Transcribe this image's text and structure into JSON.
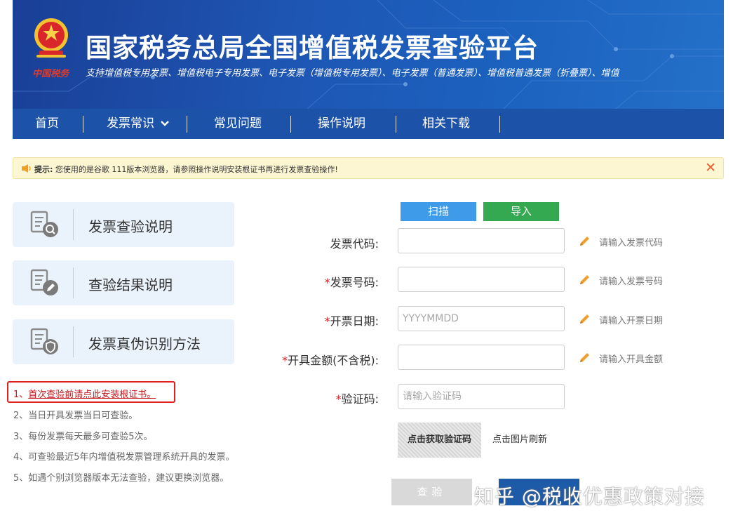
{
  "header": {
    "title": "国家税务总局全国增值税发票查验平台",
    "subtitle": "支持增值税专用发票、增值税电子专用发票、电子发票（增值税专用发票）、电子发票（普通发票）、增值税普通发票（折叠票）、增值",
    "emblem_caption": "中国税务"
  },
  "nav": {
    "items": [
      {
        "label": "首页"
      },
      {
        "label": "发票常识",
        "has_dropdown": true
      },
      {
        "label": "常见问题"
      },
      {
        "label": "操作说明"
      },
      {
        "label": "相关下载"
      }
    ]
  },
  "notice": {
    "prefix": "提示:",
    "text": "您使用的是谷歌 111版本浏览器，请参照操作说明安装根证书再进行发票查验操作!",
    "close": "✕"
  },
  "sidebar": {
    "cards": [
      {
        "label": "发票查验说明",
        "icon": "doc-search-icon"
      },
      {
        "label": "查验结果说明",
        "icon": "doc-edit-icon"
      },
      {
        "label": "发票真伪识别方法",
        "icon": "doc-shield-icon"
      }
    ]
  },
  "notes": {
    "first_prefix": "1、",
    "first_link": "首次查验前请点此安装根证书。",
    "items": [
      "2、当日开具发票当日可查验。",
      "3、每份发票每天最多可查验5次。",
      "4、可查验最近5年内增值税发票管理系统开具的发票。",
      "5、如遇个别浏览器版本无法查验，建议更换浏览器。"
    ]
  },
  "form": {
    "scan": "扫描",
    "import": "导入",
    "code_label": "发票代码:",
    "code_hint": "请输入发票代码",
    "number_label": "发票号码:",
    "number_hint": "请输入发票号码",
    "date_label": "开票日期:",
    "date_placeholder": "YYYYMMDD",
    "date_hint": "请输入开票日期",
    "amount_label": "开具金额(不含税):",
    "amount_hint": "请输入开具金额",
    "captcha_label": "验证码:",
    "captcha_placeholder": "请输入验证码",
    "captcha_image_text": "点击获取验证码",
    "refresh": "点击图片刷新",
    "query": "查验",
    "required_mark": "*"
  },
  "watermark": "知乎 @税收优惠政策对接",
  "colors": {
    "banner": "#1e56b4",
    "nav": "#1c52a8",
    "scan": "#3d9be9",
    "import": "#35a852",
    "required": "#e02020"
  }
}
